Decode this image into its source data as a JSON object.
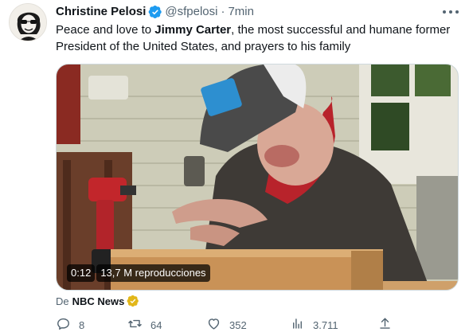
{
  "tweet": {
    "author_name": "Christine Pelosi",
    "handle": "@sfpelosi",
    "separator": "·",
    "time": "7min",
    "text_before": "Peace and love to ",
    "text_bold": "Jimmy Carter",
    "text_after": ", the most successful and humane former President of the United States, and prayers to his family"
  },
  "media": {
    "duration": "0:12",
    "views": "13,7 M reproducciones"
  },
  "source": {
    "prefix": "De",
    "name": "NBC News"
  },
  "actions": {
    "replies": "8",
    "retweets": "64",
    "likes": "352",
    "views": "3.711"
  },
  "colors": {
    "text_primary": "#0f1419",
    "text_secondary": "#536471",
    "verified_blue": "#1d9bf0",
    "verified_gold": "#e2b719",
    "bandana_red": "#b8232b"
  },
  "icons": [
    "verified-icon",
    "more-icon",
    "gold-verified-icon",
    "reply-icon",
    "retweet-icon",
    "like-icon",
    "views-icon",
    "share-icon"
  ]
}
